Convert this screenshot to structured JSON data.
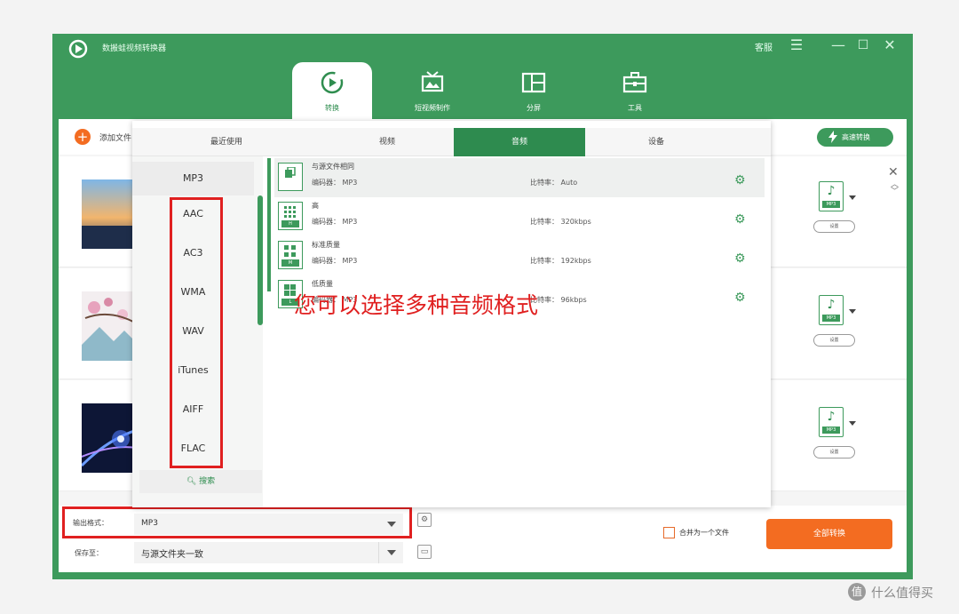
{
  "window": {
    "title": "数搬蛙视频转换器",
    "login_label": "客服",
    "menu_icon": "menu-icon",
    "minimize_icon": "minimize-icon",
    "maximize_icon": "maximize-icon",
    "close_icon": "close-icon"
  },
  "nav": {
    "tabs": [
      {
        "label": "转换",
        "icon": "convert-icon",
        "active": true
      },
      {
        "label": "短视频制作",
        "icon": "short-video-icon",
        "active": false
      },
      {
        "label": "分屏",
        "icon": "split-screen-icon",
        "active": false
      },
      {
        "label": "工具",
        "icon": "toolbox-icon",
        "active": false
      }
    ]
  },
  "toolbar": {
    "add_file_label": "添加文件",
    "fast_convert_label": "高速转换"
  },
  "files": [
    {
      "format": "MP3",
      "settings_label": "设置"
    },
    {
      "format": "MP3",
      "settings_label": "设置"
    },
    {
      "format": "MP3",
      "settings_label": "设置"
    }
  ],
  "popup": {
    "tabs": [
      {
        "label": "最近使用",
        "active": false
      },
      {
        "label": "视频",
        "active": false
      },
      {
        "label": "音频",
        "active": true
      },
      {
        "label": "设备",
        "active": false
      }
    ],
    "formats": [
      "MP3",
      "AAC",
      "AC3",
      "WMA",
      "WAV",
      "iTunes",
      "AIFF",
      "FLAC"
    ],
    "selected_format": "MP3",
    "search_label": "搜索",
    "encoder_prefix": "编码器：",
    "bitrate_prefix": "比特率：",
    "presets": [
      {
        "name": "与源文件相同",
        "encoder": "MP3",
        "bitrate": "Auto",
        "tag": ""
      },
      {
        "name": "高",
        "encoder": "MP3",
        "bitrate": "320kbps",
        "tag": "H"
      },
      {
        "name": "标准质量",
        "encoder": "MP3",
        "bitrate": "192kbps",
        "tag": "M"
      },
      {
        "name": "低质量",
        "encoder": "MP3",
        "bitrate": "96kbps",
        "tag": "L"
      }
    ]
  },
  "annotation": "您可以选择多种音频格式",
  "bottom": {
    "output_format_label": "输出格式：",
    "output_format_value": "MP3",
    "save_to_label": "保存至：",
    "save_to_value": "与源文件夹一致",
    "merge_label": "合并为一个文件",
    "convert_all_label": "全部转换"
  },
  "watermark": {
    "badge": "值",
    "text": "什么值得买"
  },
  "colors": {
    "brand_green": "#3d9a5c",
    "accent_orange": "#f36c21",
    "annotation_red": "#e02020"
  }
}
